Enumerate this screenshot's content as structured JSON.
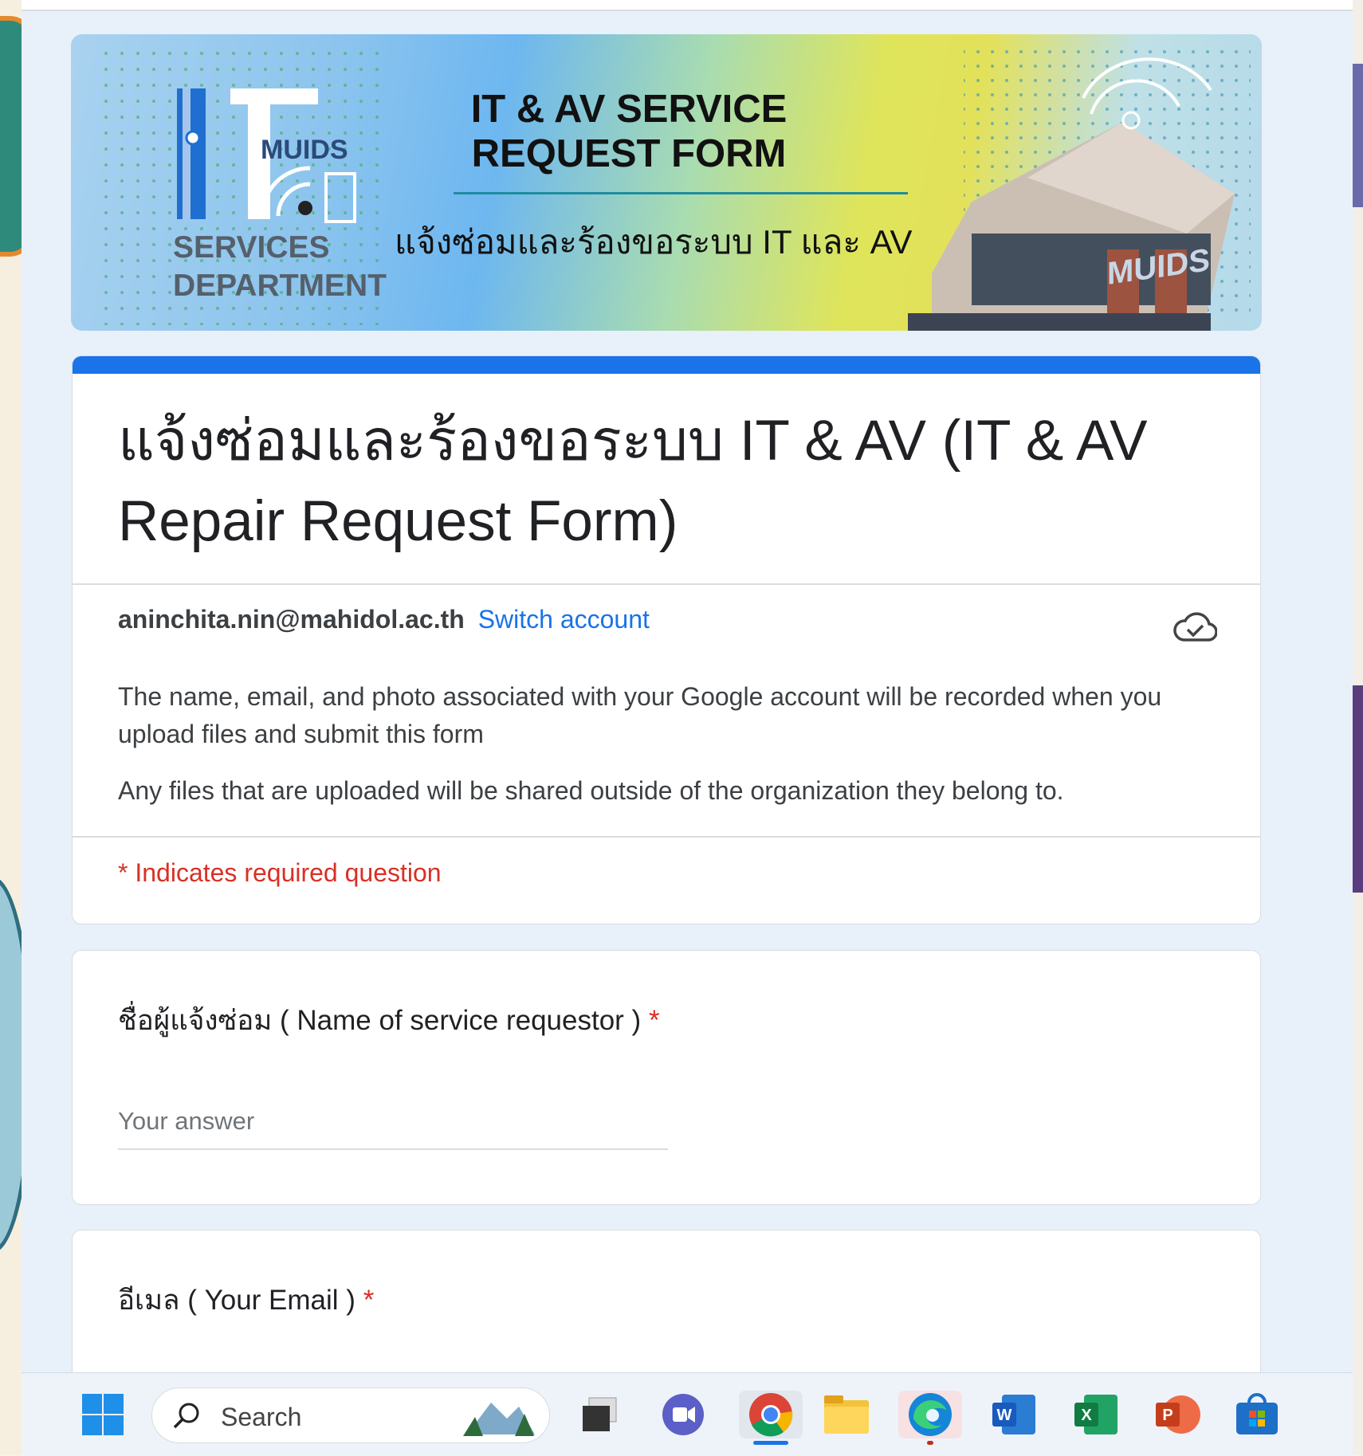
{
  "banner": {
    "title_line1": "IT & AV SERVICE",
    "title_line2": "REQUEST FORM",
    "subtitle_thai": "แจ้งซ่อมและร้องขอระบบ IT และ AV",
    "logo_text": "MUIDS",
    "dept_line1": "SERVICES",
    "dept_line2": "DEPARTMENT",
    "building_sign": "MUIDS"
  },
  "form": {
    "title": "แจ้งซ่อมและร้องขอระบบ IT & AV  (IT & AV Repair  Request Form)",
    "account_email": "aninchita.nin@mahidol.ac.th",
    "switch_account": "Switch account",
    "notice_1": "The name, email, and photo associated with your Google account will be recorded when you upload files and submit this form",
    "notice_2": "Any files that are uploaded will be shared outside of the organization they belong to.",
    "required_note": "* Indicates required question"
  },
  "questions": [
    {
      "label": "ชื่อผู้แจ้งซ่อม ( Name of service requestor )",
      "required_mark": "*",
      "placeholder": "Your answer"
    },
    {
      "label": "อีเมล ( Your Email )",
      "required_mark": "*"
    }
  ],
  "taskbar": {
    "search_placeholder": "Search",
    "icons": [
      "windows-start-icon",
      "search-icon",
      "task-view-icon",
      "teams-icon",
      "chrome-icon",
      "file-explorer-icon",
      "edge-icon",
      "word-icon",
      "excel-icon",
      "powerpoint-icon",
      "microsoft-store-icon"
    ]
  },
  "colors": {
    "accent": "#1a73e8",
    "required": "#d93025",
    "page_bg": "#e8f0fa"
  }
}
